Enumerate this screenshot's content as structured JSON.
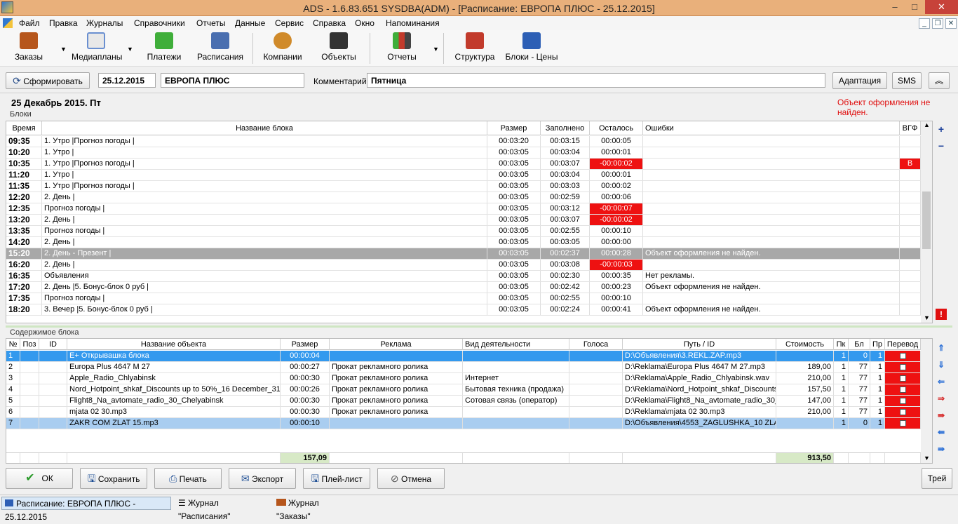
{
  "window": {
    "title": "ADS - 1.6.83.651 SYSDBA(ADM) - [Расписание:  ЕВРОПА ПЛЮС - 25.12.2015]",
    "min": "–",
    "max": "□",
    "close": "✕"
  },
  "menu": [
    "Файл",
    "Правка",
    "Журналы",
    "Справочники",
    "Отчеты",
    "Данные",
    "Сервис",
    "Справка",
    "Окно",
    "Напоминания"
  ],
  "toolbar": [
    {
      "label": "Заказы",
      "icon": "orders-icon",
      "color": "#b6561c"
    },
    {
      "label": "Медиапланы",
      "icon": "mediaplans-icon",
      "color": "#6a8fd0"
    },
    {
      "label": "Платежи",
      "icon": "payments-icon",
      "color": "#3fae3a"
    },
    {
      "label": "Расписания",
      "icon": "schedule-icon",
      "color": "#4a6fb0"
    },
    {
      "label": "Компании",
      "icon": "companies-icon",
      "color": "#d08a2a"
    },
    {
      "label": "Объекты",
      "icon": "objects-icon",
      "color": "#333333"
    },
    {
      "label": "Отчеты",
      "icon": "reports-icon",
      "color": "#c23b2c"
    },
    {
      "label": "Структура",
      "icon": "structure-icon",
      "color": "#c23b2c"
    },
    {
      "label": "Блоки - Цены",
      "icon": "blocks-prices-icon",
      "color": "#2d5fb5"
    }
  ],
  "form": {
    "generate_label": "Сформировать",
    "date": "25.12.2015",
    "station": "ЕВРОПА ПЛЮС",
    "comment_label": "Комментарий",
    "comment": "Пятница",
    "adapt_label": "Адаптация",
    "sms_label": "SMS",
    "collapse": "︽"
  },
  "day_header": "25 Декабрь 2015. Пт",
  "error_message": "Объект оформления не найден.",
  "blocks": {
    "section_label": "Блоки",
    "columns": [
      "Время",
      "Название блока",
      "Размер",
      "Заполнено",
      "Осталось",
      "Ошибки",
      "ВГФ"
    ],
    "rows": [
      {
        "time": "09:35",
        "name": "1. Утро |Прогноз погоды |",
        "size": "00:03:20",
        "filled": "00:03:15",
        "left": "00:00:05",
        "errors": "",
        "vgf": ""
      },
      {
        "time": "10:20",
        "name": "1. Утро |",
        "size": "00:03:05",
        "filled": "00:03:04",
        "left": "00:00:01",
        "errors": "",
        "vgf": ""
      },
      {
        "time": "10:35",
        "name": "1. Утро |Прогноз погоды |",
        "size": "00:03:05",
        "filled": "00:03:07",
        "left": "-00:00:02",
        "errors": "",
        "vgf": "В"
      },
      {
        "time": "11:20",
        "name": "1. Утро |",
        "size": "00:03:05",
        "filled": "00:03:04",
        "left": "00:00:01",
        "errors": "",
        "vgf": ""
      },
      {
        "time": "11:35",
        "name": "1. Утро |Прогноз погоды |",
        "size": "00:03:05",
        "filled": "00:03:03",
        "left": "00:00:02",
        "errors": "",
        "vgf": ""
      },
      {
        "time": "12:20",
        "name": "2. День |",
        "size": "00:03:05",
        "filled": "00:02:59",
        "left": "00:00:06",
        "errors": "",
        "vgf": ""
      },
      {
        "time": "12:35",
        "name": "Прогноз погоды |",
        "size": "00:03:05",
        "filled": "00:03:12",
        "left": "-00:00:07",
        "errors": "",
        "vgf": ""
      },
      {
        "time": "13:20",
        "name": "2. День |",
        "size": "00:03:05",
        "filled": "00:03:07",
        "left": "-00:00:02",
        "errors": "",
        "vgf": ""
      },
      {
        "time": "13:35",
        "name": "Прогноз погоды |",
        "size": "00:03:05",
        "filled": "00:02:55",
        "left": "00:00:10",
        "errors": "",
        "vgf": ""
      },
      {
        "time": "14:20",
        "name": "2. День |",
        "size": "00:03:05",
        "filled": "00:03:05",
        "left": "00:00:00",
        "errors": "",
        "vgf": ""
      },
      {
        "time": "15:20",
        "name": "2. День - Презент |",
        "size": "00:03:05",
        "filled": "00:02:37",
        "left": "00:00:28",
        "errors": "Объект оформления не найден.",
        "vgf": "",
        "selected": true
      },
      {
        "time": "16:20",
        "name": "2. День |",
        "size": "00:03:05",
        "filled": "00:03:08",
        "left": "-00:00:03",
        "errors": "",
        "vgf": ""
      },
      {
        "time": "16:35",
        "name": "Объявления",
        "size": "00:03:05",
        "filled": "00:02:30",
        "left": "00:00:35",
        "errors": "Нет рекламы.",
        "vgf": ""
      },
      {
        "time": "17:20",
        "name": "2. День |5. Бонус-блок 0 руб |",
        "size": "00:03:05",
        "filled": "00:02:42",
        "left": "00:00:23",
        "errors": "Объект оформления не найден.",
        "vgf": ""
      },
      {
        "time": "17:35",
        "name": "Прогноз погоды |",
        "size": "00:03:05",
        "filled": "00:02:55",
        "left": "00:00:10",
        "errors": "",
        "vgf": ""
      },
      {
        "time": "18:20",
        "name": "3. Вечер |5. Бонус-блок 0 руб |",
        "size": "00:03:05",
        "filled": "00:02:24",
        "left": "00:00:41",
        "errors": "Объект оформления не найден.",
        "vgf": ""
      }
    ],
    "side": {
      "add": "+",
      "remove": "−",
      "warn": "!"
    }
  },
  "content": {
    "section_label": "Содержимое блока",
    "columns": [
      "№",
      "Поз",
      "ID",
      "Название объекта",
      "Размер",
      "Реклама",
      "Вид деятельности",
      "Голоса",
      "Путь / ID",
      "Стоимость",
      "Пк",
      "Бл",
      "Пр",
      "Перевод"
    ],
    "rows": [
      {
        "n": "1",
        "pos": "",
        "id": "",
        "name": "E+ Открывашка блока",
        "size": "00:00:04",
        "ad": "",
        "activity": "",
        "voices": "",
        "path": "D:\\Объявления\\3.REKL.ZAP.mp3",
        "cost": "",
        "pk": "1",
        "bl": "0",
        "pr": "1",
        "state": "selblue"
      },
      {
        "n": "2",
        "pos": "",
        "id": "",
        "name": "Europa Plus 4647 M 27",
        "size": "00:00:27",
        "ad": "Прокат рекламного ролика",
        "activity": "",
        "voices": "",
        "path": "D:\\Reklama\\Europa Plus 4647 M 27.mp3",
        "cost": "189,00",
        "pk": "1",
        "bl": "77",
        "pr": "1",
        "state": ""
      },
      {
        "n": "3",
        "pos": "",
        "id": "",
        "name": "Apple_Radio_Chlyabinsk",
        "size": "00:00:30",
        "ad": "Прокат рекламного ролика",
        "activity": "Интернет",
        "voices": "",
        "path": "D:\\Reklama\\Apple_Radio_Chlyabinsk.wav",
        "cost": "210,00",
        "pk": "1",
        "bl": "77",
        "pr": "1",
        "state": ""
      },
      {
        "n": "4",
        "pos": "",
        "id": "",
        "name": "Nord_Hotpoint_shkaf_Discounts up to 50%_16 December_31 D",
        "size": "00:00:26",
        "ad": "Прокат рекламного ролика",
        "activity": "Бытовая техника (продажа)",
        "voices": "",
        "path": "D:\\Reklama\\Nord_Hotpoint_shkaf_Discounts",
        "cost": "157,50",
        "pk": "1",
        "bl": "77",
        "pr": "1",
        "state": ""
      },
      {
        "n": "5",
        "pos": "",
        "id": "",
        "name": "Flight8_Na_avtomate_radio_30_Chelyabinsk",
        "size": "00:00:30",
        "ad": "Прокат рекламного ролика",
        "activity": "Сотовая связь (оператор)",
        "voices": "",
        "path": "D:\\Reklama\\Flight8_Na_avtomate_radio_30_",
        "cost": "147,00",
        "pk": "1",
        "bl": "77",
        "pr": "1",
        "state": ""
      },
      {
        "n": "6",
        "pos": "",
        "id": "",
        "name": "mjata 02 30.mp3",
        "size": "00:00:30",
        "ad": "Прокат рекламного ролика",
        "activity": "",
        "voices": "",
        "path": "D:\\Reklama\\mjata 02 30.mp3",
        "cost": "210,00",
        "pk": "1",
        "bl": "77",
        "pr": "1",
        "state": ""
      },
      {
        "n": "7",
        "pos": "",
        "id": "",
        "name": "ZAKR COM ZLAT 15.mp3",
        "size": "00:00:10",
        "ad": "",
        "activity": "",
        "voices": "",
        "path": "D:\\Объявления\\4553_ZAGLUSHKA_10 ZLA",
        "cost": "",
        "pk": "1",
        "bl": "0",
        "pr": "1",
        "state": "selpale"
      }
    ],
    "total_size": "157,09",
    "total_cost": "913,50"
  },
  "buttons": {
    "ok": "ОК",
    "save": "Сохранить",
    "print": "Печать",
    "export": "Экспорт",
    "playlist": "Плей-лист",
    "cancel": "Отмена",
    "trey": "Трей"
  },
  "statusbar": [
    "Расписание:  ЕВРОПА ПЛЮС - 25.12.2015",
    "Журнал \"Расписания\"",
    "Журнал \"Заказы\""
  ]
}
